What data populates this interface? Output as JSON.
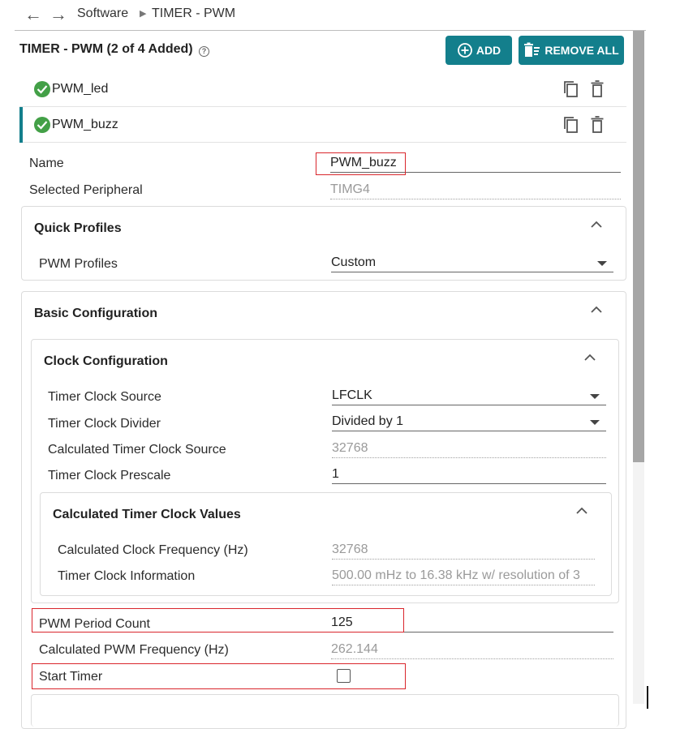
{
  "breadcrumb": {
    "root": "Software",
    "current": "TIMER - PWM"
  },
  "header": {
    "title": "TIMER - PWM (2 of 4 Added)",
    "help": "?",
    "add_label": "ADD",
    "remove_all_label": "REMOVE ALL"
  },
  "instances": [
    {
      "label": "PWM_led"
    },
    {
      "label": "PWM_buzz"
    }
  ],
  "fields": {
    "name_label": "Name",
    "name_value": "PWM_buzz",
    "peripheral_label": "Selected Peripheral",
    "peripheral_value": "TIMG4"
  },
  "quick_profiles": {
    "title": "Quick Profiles",
    "profile_label": "PWM Profiles",
    "profile_value": "Custom"
  },
  "basic": {
    "title": "Basic Configuration",
    "clock": {
      "title": "Clock Configuration",
      "source_label": "Timer Clock Source",
      "source_value": "LFCLK",
      "divider_label": "Timer Clock Divider",
      "divider_value": "Divided by 1",
      "calc_source_label": "Calculated Timer Clock Source",
      "calc_source_value": "32768",
      "prescale_label": "Timer Clock Prescale",
      "prescale_value": "1"
    },
    "calc_values": {
      "title": "Calculated Timer Clock Values",
      "freq_label": "Calculated Clock Frequency (Hz)",
      "freq_value": "32768",
      "info_label": "Timer Clock Information",
      "info_value": "500.00 mHz to 16.38 kHz w/ resolution of 3"
    },
    "period_label": "PWM Period Count",
    "period_value": "125",
    "pwm_freq_label": "Calculated PWM Frequency (Hz)",
    "pwm_freq_value": "262.144",
    "start_timer_label": "Start Timer",
    "start_timer_checked": false
  },
  "colors": {
    "accent": "#137f8c",
    "check": "#43a047",
    "highlight": "#d9262c"
  }
}
